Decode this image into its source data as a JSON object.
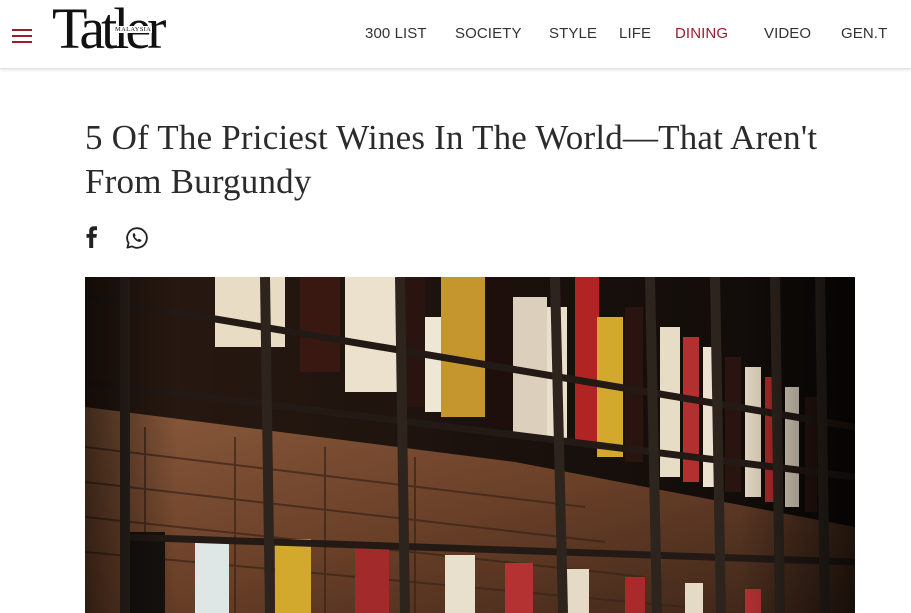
{
  "header": {
    "logo_text": "Tatler",
    "logo_edition": "MALAYSIA",
    "nav": [
      {
        "label": "300 LIST",
        "active": false
      },
      {
        "label": "SOCIETY",
        "active": false
      },
      {
        "label": "STYLE",
        "active": false
      },
      {
        "label": "LIFE",
        "active": false
      },
      {
        "label": "DINING",
        "active": true
      },
      {
        "label": "VIDEO",
        "active": false
      },
      {
        "label": "GEN.T",
        "active": false
      }
    ]
  },
  "article": {
    "title": "5 Of The Priciest Wines In The World—That Aren't From Burgundy",
    "share_icons": [
      "facebook-icon",
      "whatsapp-icon"
    ]
  },
  "hero_image": {
    "subject": "wine bottles on dark metal shelves against brick wall"
  },
  "colors": {
    "accent": "#9b1c2e",
    "text": "#2b2b2b",
    "nav_text": "#333333"
  }
}
